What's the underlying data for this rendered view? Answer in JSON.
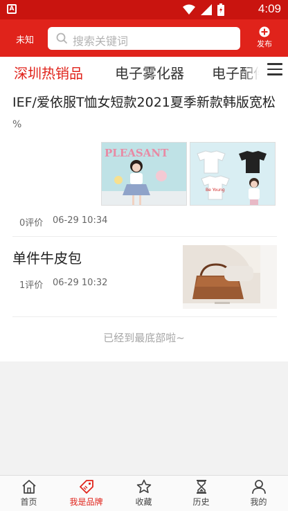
{
  "status_bar": {
    "app_badge": "A",
    "time": "4:09"
  },
  "header": {
    "location": "未知",
    "search_placeholder": "搜索关键词",
    "publish_label": "发布"
  },
  "tabs": [
    {
      "label": "深圳热销品",
      "active": true
    },
    {
      "label": "电子雾化器",
      "active": false
    },
    {
      "label": "电子配件",
      "active": false
    }
  ],
  "items": [
    {
      "title": "IEF/爱依服T恤女短款2021夏季新款韩版宽松",
      "subtitle": "%",
      "reviews": "0评价",
      "time": "06-29 10:34",
      "image1_text": "PLEASANT",
      "image2_text": "Be Young"
    },
    {
      "title": "单件牛皮包",
      "reviews": "1评价",
      "time": "06-29 10:32"
    }
  ],
  "end_text": "已经到最底部啦~",
  "bottom_nav": [
    {
      "label": "首页",
      "icon": "home-icon",
      "active": false
    },
    {
      "label": "我是品牌",
      "icon": "tag-icon",
      "active": true
    },
    {
      "label": "收藏",
      "icon": "star-icon",
      "active": false
    },
    {
      "label": "历史",
      "icon": "hourglass-icon",
      "active": false
    },
    {
      "label": "我的",
      "icon": "user-icon",
      "active": false
    }
  ],
  "colors": {
    "brand_red": "#e0231b",
    "status_red": "#c9140f"
  }
}
